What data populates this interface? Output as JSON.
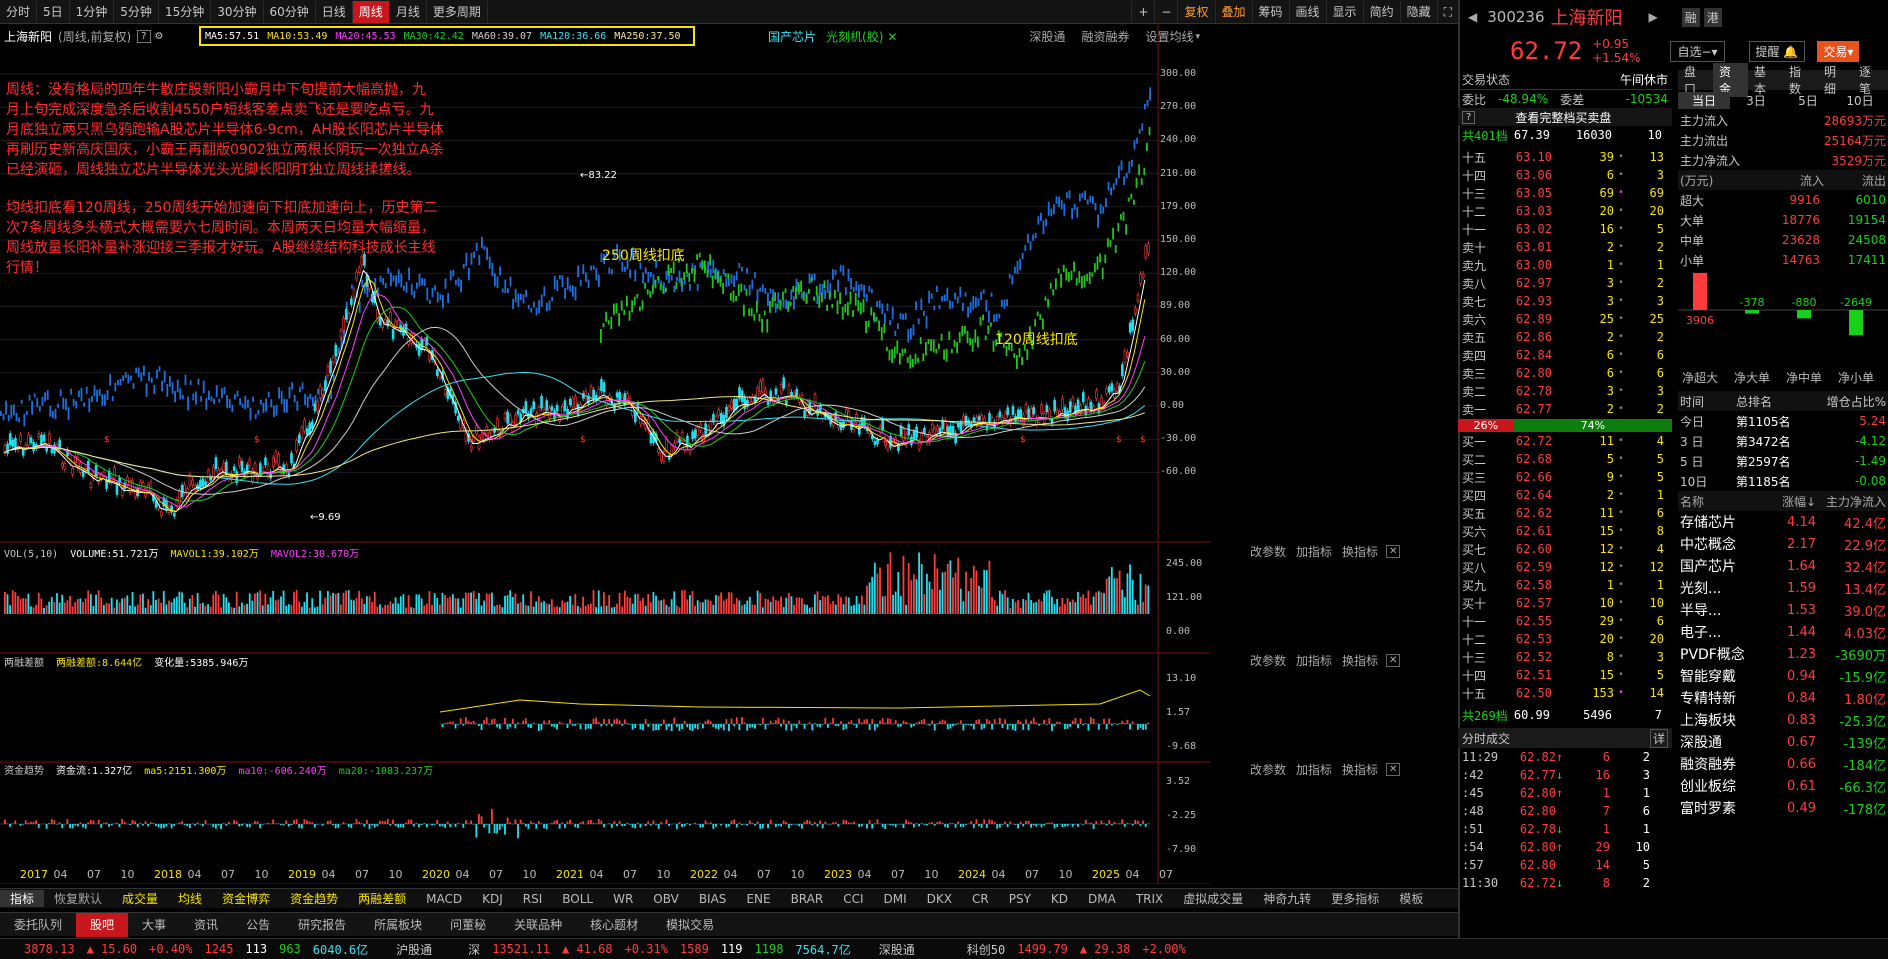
{
  "toolbar": {
    "periods": [
      "分时",
      "5日",
      "1分钟",
      "5分钟",
      "15分钟",
      "30分钟",
      "60分钟",
      "日线",
      "周线",
      "月线",
      "更多周期"
    ],
    "active_period": "周线",
    "right_tools": [
      "+",
      "−",
      "复权",
      "叠加",
      "筹码",
      "画线",
      "显示",
      "简约",
      "隐藏",
      "⛶"
    ]
  },
  "chart": {
    "stock_name": "上海新阳",
    "chart_mode": "(周线,前复权)",
    "ma_legend": [
      {
        "label": "MA5:57.51",
        "color": "#ffffff"
      },
      {
        "label": "MA10:53.49",
        "color": "#f7e400"
      },
      {
        "label": "MA20:45.53",
        "color": "#ff3cff"
      },
      {
        "label": "MA30:42.42",
        "color": "#18d018"
      },
      {
        "label": "MA60:39.07",
        "color": "#cfcfcf"
      },
      {
        "label": "MA120:36.66",
        "color": "#3ce0f0"
      },
      {
        "label": "MA250:37.50",
        "color": "#f0e68c"
      }
    ],
    "overlay_tags": [
      "国产芯片",
      "光刻机(胶)"
    ],
    "top_right_links": [
      "深股通",
      "融资融券",
      "设置均线"
    ],
    "annotation_1": [
      "周线：没有格局的四年牛散庄股新阳小霸月中下旬提前大幅高抛，九",
      "月上旬完成深度急杀后收割4550户短线客差点卖飞还是要吃点亏。九",
      "月底独立两只黑乌鸦跑输A股芯片半导体6-9cm，AH股长阳芯片半导体",
      "再刷历史新高庆国庆，小霸王再翻版0902独立两根长阴玩一次独立A杀",
      "已经演砸，周线独立芯片半导体光头光脚长阳阴T独立周线揉搓线。"
    ],
    "annotation_2": [
      "均线扣底看120周线，250周线开始加速向下扣底加速向上，历史第二",
      "次7条周线多头横式大概需要六七周时间。本周两天日均量大幅缩量，",
      "周线放量长阳补量补涨迎接三季报才好玩。A股继续结构科技成长主线",
      "行情！"
    ],
    "label_250": "250周线扣底",
    "label_120": "120周线扣底",
    "high_label": "83.22",
    "low_label": "9.69",
    "y_ticks": [
      "300.00",
      "270.00",
      "240.00",
      "210.00",
      "179.00",
      "150.00",
      "120.00",
      "89.00",
      "60.00",
      "30.00",
      "0.00",
      "-30.00",
      "-60.00"
    ],
    "years": [
      "2017",
      "04",
      "07",
      "10",
      "2018",
      "04",
      "07",
      "10",
      "2019",
      "04",
      "07",
      "10",
      "2020",
      "04",
      "07",
      "10",
      "2021",
      "04",
      "07",
      "10",
      "2022",
      "04",
      "07",
      "10",
      "2023",
      "04",
      "07",
      "10",
      "2024",
      "04",
      "07",
      "10",
      "2025",
      "04",
      "07"
    ]
  },
  "vol": {
    "title": "VOL(5,10)",
    "items": [
      "VOLUME:51.721万",
      "MAVOL1:39.102万",
      "MAVOL2:30.670万"
    ],
    "y_ticks": [
      "245.00",
      "121.00",
      "0.00"
    ]
  },
  "margin": {
    "title": "两融差额",
    "items": [
      "两融差额:8.644亿",
      "变化量:5385.946万"
    ],
    "y_ticks": [
      "13.10",
      "1.57",
      "-9.68"
    ]
  },
  "fund": {
    "title": "资金趋势",
    "items": [
      "资金流:1.327亿",
      "ma5:2151.300万",
      "ma10:-606.240万",
      "ma20:-1083.237万"
    ],
    "y_ticks": [
      "3.52",
      "-2.25",
      "-7.90"
    ]
  },
  "subpanel_ctl": [
    "改参数",
    "加指标",
    "换指标"
  ],
  "indicator_tabs": [
    "指标",
    "恢复默认",
    "成交量",
    "均线",
    "资金博弈",
    "资金趋势",
    "两融差额",
    "MACD",
    "KDJ",
    "RSI",
    "BOLL",
    "WR",
    "OBV",
    "BIAS",
    "ENE",
    "BRAR",
    "CCI",
    "DMI",
    "DKX",
    "CR",
    "PSY",
    "KD",
    "DMA",
    "TRIX",
    "虚拟成交量",
    "神奇九转",
    "更多指标",
    "模板"
  ],
  "bottom_tabs": [
    "委托队列",
    "股吧",
    "大事",
    "资讯",
    "公告",
    "研究报告",
    "所属板块",
    "问董秘",
    "关联品种",
    "核心题材",
    "模拟交易"
  ],
  "active_bottom_tab": "股吧",
  "status": {
    "sh": "3878.13",
    "sh_chg": "▲ 15.60",
    "sh_pct": "+0.40%",
    "sh_ud": "1245",
    "sh_f": "113",
    "sh_d": "963",
    "sh_amt": "6040.6亿",
    "hgt": "沪股通",
    "sz_label": "深",
    "sz": "13521.11",
    "sz_chg": "▲ 41.68",
    "sz_pct": "+0.31%",
    "sz_ud": "1589",
    "sz_f": "119",
    "sz_d": "1198",
    "sz_amt": "7564.7亿",
    "sgt": "深股通",
    "kc_label": "科创50",
    "kc": "1499.79",
    "kc_chg": "▲ 29.38",
    "kc_pct": "+2.00%"
  },
  "quote": {
    "code": "300236",
    "name": "上海新阳",
    "price": "62.72",
    "chg": "+0.95",
    "pct": "+1.54%",
    "buttons": [
      "融",
      "港",
      "自选",
      "提醒",
      "交易"
    ],
    "trade_state_label": "交易状态",
    "trade_state": "午间休市",
    "wb_label": "委比",
    "wb": "-48.94%",
    "wc_label": "委差",
    "wc": "-10534",
    "full_book": "查看完整档买卖盘",
    "total_sell": "共401档",
    "total_sell_p": "67.39",
    "total_sell_v": "16030",
    "total_sell_c": "10",
    "total_buy": "共269档",
    "total_buy_p": "60.99",
    "total_buy_v": "5496",
    "total_buy_c": "7",
    "ratio_buy": "26%",
    "ratio_sell": "74%"
  },
  "asks": [
    [
      "十五",
      "63.10",
      "39",
      "13"
    ],
    [
      "十四",
      "63.06",
      "6",
      "3"
    ],
    [
      "十三",
      "63.05",
      "69",
      "69"
    ],
    [
      "十二",
      "63.03",
      "20",
      "20"
    ],
    [
      "十一",
      "63.02",
      "16",
      "5"
    ],
    [
      "卖十",
      "63.01",
      "2",
      "2"
    ],
    [
      "卖九",
      "63.00",
      "1",
      "1"
    ],
    [
      "卖八",
      "62.97",
      "3",
      "2"
    ],
    [
      "卖七",
      "62.93",
      "3",
      "3"
    ],
    [
      "卖六",
      "62.89",
      "25",
      "25"
    ],
    [
      "卖五",
      "62.86",
      "2",
      "2"
    ],
    [
      "卖四",
      "62.84",
      "6",
      "6"
    ],
    [
      "卖三",
      "62.80",
      "6",
      "6"
    ],
    [
      "卖二",
      "62.78",
      "3",
      "3"
    ],
    [
      "卖一",
      "62.77",
      "2",
      "2"
    ]
  ],
  "bids": [
    [
      "买一",
      "62.72",
      "11",
      "4"
    ],
    [
      "买二",
      "62.68",
      "5",
      "5"
    ],
    [
      "买三",
      "62.66",
      "9",
      "5"
    ],
    [
      "买四",
      "62.64",
      "2",
      "1"
    ],
    [
      "买五",
      "62.62",
      "11",
      "6"
    ],
    [
      "买六",
      "62.61",
      "15",
      "8"
    ],
    [
      "买七",
      "62.60",
      "12",
      "4"
    ],
    [
      "买八",
      "62.59",
      "12",
      "12"
    ],
    [
      "买九",
      "62.58",
      "1",
      "1"
    ],
    [
      "买十",
      "62.57",
      "10",
      "10"
    ],
    [
      "十一",
      "62.55",
      "29",
      "6"
    ],
    [
      "十二",
      "62.53",
      "20",
      "20"
    ],
    [
      "十三",
      "62.52",
      "8",
      "3"
    ],
    [
      "十四",
      "62.51",
      "15",
      "5"
    ],
    [
      "十五",
      "62.50",
      "153",
      "14"
    ]
  ],
  "ticks_header": "分时成交",
  "ticks_detail": "详",
  "ticks": [
    [
      "11:29",
      "62.82",
      "↑",
      "6",
      "2"
    ],
    [
      ":42",
      "62.77",
      "↓",
      "16",
      "3"
    ],
    [
      ":45",
      "62.80",
      "↑",
      "1",
      "1"
    ],
    [
      ":48",
      "62.80",
      "",
      "7",
      "6"
    ],
    [
      ":51",
      "62.78",
      "↓",
      "1",
      "1"
    ],
    [
      ":54",
      "62.80",
      "↑",
      "29",
      "10"
    ],
    [
      ":57",
      "62.80",
      "",
      "14",
      "5"
    ],
    [
      "11:30",
      "62.72",
      "↓",
      "8",
      "2"
    ]
  ],
  "fund_tabs": [
    "盘口",
    "资金",
    "基本",
    "指数",
    "明细",
    "逐笔"
  ],
  "fund_day_tabs": [
    "当日",
    "3日",
    "5日",
    "10日"
  ],
  "main_flow": [
    [
      "主力流入",
      "28693万元"
    ],
    [
      "主力流出",
      "25164万元"
    ],
    [
      "主力净流入",
      "3529万元"
    ]
  ],
  "flow_unit": "(万元)",
  "flow_in": "流入",
  "flow_out": "流出",
  "flow_table": [
    [
      "超大",
      "9916",
      "6010"
    ],
    [
      "大单",
      "18776",
      "19154"
    ],
    [
      "中单",
      "23628",
      "24508"
    ],
    [
      "小单",
      "14763",
      "17411"
    ]
  ],
  "net_bars": {
    "values": [
      3906,
      -378,
      -880,
      -2649
    ],
    "labels": [
      "净超大",
      "净大单",
      "净中单",
      "净小单"
    ]
  },
  "rank_header": [
    "时间",
    "总排名",
    "增仓占比%"
  ],
  "ranks": [
    [
      "今日",
      "第1105名",
      "5.24"
    ],
    [
      "3 日",
      "第3472名",
      "-4.12"
    ],
    [
      "5 日",
      "第2597名",
      "-1.49"
    ],
    [
      "10日",
      "第1185名",
      "-0.08"
    ]
  ],
  "sector_header": [
    "名称",
    "涨幅↓",
    "主力净流入"
  ],
  "sectors": [
    [
      "存储芯片",
      "4.14",
      "42.4亿"
    ],
    [
      "中芯概念",
      "2.17",
      "22.9亿"
    ],
    [
      "国产芯片",
      "1.64",
      "32.4亿"
    ],
    [
      "光刻...",
      "1.59",
      "13.4亿"
    ],
    [
      "半导...",
      "1.53",
      "39.0亿"
    ],
    [
      "电子...",
      "1.44",
      "4.03亿"
    ],
    [
      "PVDF概念",
      "1.23",
      "-3690万"
    ],
    [
      "智能穿戴",
      "0.94",
      "-15.9亿"
    ],
    [
      "专精特新",
      "0.84",
      "1.80亿"
    ],
    [
      "上海板块",
      "0.83",
      "-25.3亿"
    ],
    [
      "深股通",
      "0.67",
      "-139亿"
    ],
    [
      "融资融券",
      "0.66",
      "-184亿"
    ],
    [
      "创业板综",
      "0.61",
      "-66.3亿"
    ],
    [
      "富时罗素",
      "0.49",
      "-178亿"
    ]
  ]
}
